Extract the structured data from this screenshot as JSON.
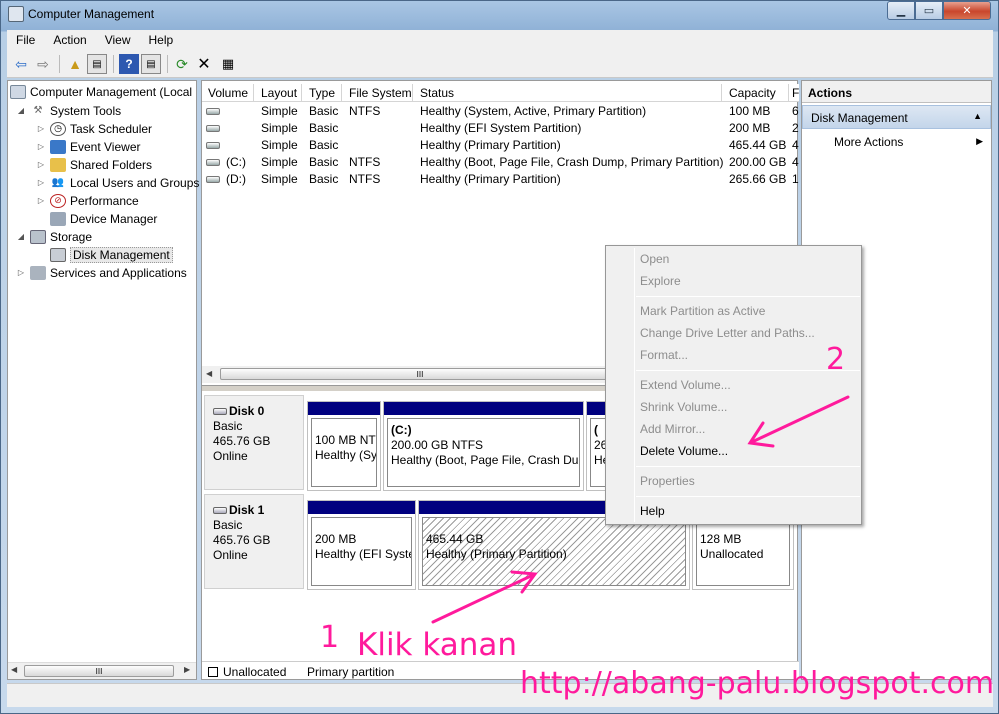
{
  "window": {
    "title": "Computer Management"
  },
  "menubar": [
    "File",
    "Action",
    "View",
    "Help"
  ],
  "toolbar": {
    "icons": [
      "back-arrow-icon",
      "forward-arrow-icon",
      "up-folder-icon",
      "show-hide-tree-icon",
      "help-icon",
      "show-hide-action-pane-icon",
      "refresh-icon",
      "delete-icon",
      "properties-icon"
    ]
  },
  "tree": {
    "root": "Computer Management (Local",
    "system_tools": "System Tools",
    "items": [
      "Task Scheduler",
      "Event Viewer",
      "Shared Folders",
      "Local Users and Groups",
      "Performance",
      "Device Manager"
    ],
    "storage": "Storage",
    "disk_management": "Disk Management",
    "services": "Services and Applications"
  },
  "volume_table": {
    "headers": [
      "Volume",
      "Layout",
      "Type",
      "File System",
      "Status",
      "Capacity",
      "F"
    ],
    "rows": [
      {
        "volume": "",
        "layout": "Simple",
        "type": "Basic",
        "fs": "NTFS",
        "status": "Healthy (System, Active, Primary Partition)",
        "capacity": "100 MB",
        "f": "6"
      },
      {
        "volume": "",
        "layout": "Simple",
        "type": "Basic",
        "fs": "",
        "status": "Healthy (EFI System Partition)",
        "capacity": "200 MB",
        "f": "2"
      },
      {
        "volume": "",
        "layout": "Simple",
        "type": "Basic",
        "fs": "",
        "status": "Healthy (Primary Partition)",
        "capacity": "465.44 GB",
        "f": "4"
      },
      {
        "volume": "(C:)",
        "layout": "Simple",
        "type": "Basic",
        "fs": "NTFS",
        "status": "Healthy (Boot, Page File, Crash Dump, Primary Partition)",
        "capacity": "200.00 GB",
        "f": "4"
      },
      {
        "volume": "(D:)",
        "layout": "Simple",
        "type": "Basic",
        "fs": "NTFS",
        "status": "Healthy (Primary Partition)",
        "capacity": "265.66 GB",
        "f": "1"
      }
    ],
    "scroll_grip": "III"
  },
  "disks": [
    {
      "name": "Disk 0",
      "type": "Basic",
      "size": "465.76 GB",
      "state": "Online",
      "partitions": [
        {
          "line1": "100 MB NTI",
          "line2": "Healthy (Sy"
        },
        {
          "title": "(C:)",
          "line1": "200.00 GB NTFS",
          "line2": "Healthy (Boot, Page File, Crash Dum"
        },
        {
          "title": "(",
          "line1": "26",
          "line2": "He"
        }
      ]
    },
    {
      "name": "Disk 1",
      "type": "Basic",
      "size": "465.76 GB",
      "state": "Online",
      "partitions": [
        {
          "line1": "200 MB",
          "line2": "Healthy (EFI Syster"
        },
        {
          "line1": "465.44 GB",
          "line2": "Healthy (Primary Partition)"
        },
        {
          "line1": "128 MB",
          "line2": "Unallocated"
        }
      ]
    }
  ],
  "legend": [
    {
      "label": "Unallocated",
      "color": "#000000"
    },
    {
      "label": "Primary partition",
      "color": "#00007f"
    }
  ],
  "actions": {
    "header": "Actions",
    "group": "Disk Management",
    "more": "More Actions"
  },
  "context_menu": {
    "items": [
      {
        "label": "Open",
        "enabled": false
      },
      {
        "label": "Explore",
        "enabled": false
      },
      {
        "label": "Mark Partition as Active",
        "enabled": false
      },
      {
        "label": "Change Drive Letter and Paths...",
        "enabled": false
      },
      {
        "label": "Format...",
        "enabled": false
      },
      {
        "label": "Extend Volume...",
        "enabled": false
      },
      {
        "label": "Shrink Volume...",
        "enabled": false
      },
      {
        "label": "Add Mirror...",
        "enabled": false
      },
      {
        "label": "Delete Volume...",
        "enabled": true
      },
      {
        "label": "Properties",
        "enabled": false
      },
      {
        "label": "Help",
        "enabled": true
      }
    ]
  },
  "annotations": {
    "step1": "1",
    "step1_text": "Klik kanan",
    "step2": "2",
    "url": "http://abang-palu.blogspot.com",
    "color": "#ff1a9c"
  },
  "colors": {
    "primary_partition": "#00007f",
    "unallocated": "#000000",
    "selection": "#c3d5ea"
  }
}
